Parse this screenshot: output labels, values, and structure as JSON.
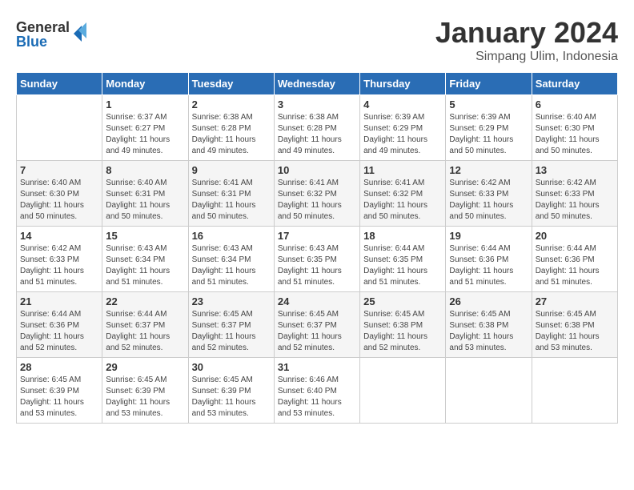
{
  "logo": {
    "line1": "General",
    "line2": "Blue"
  },
  "title": "January 2024",
  "subtitle": "Simpang Ulim, Indonesia",
  "weekdays": [
    "Sunday",
    "Monday",
    "Tuesday",
    "Wednesday",
    "Thursday",
    "Friday",
    "Saturday"
  ],
  "weeks": [
    [
      {
        "day": "",
        "sunrise": "",
        "sunset": "",
        "daylight": ""
      },
      {
        "day": "1",
        "sunrise": "Sunrise: 6:37 AM",
        "sunset": "Sunset: 6:27 PM",
        "daylight": "Daylight: 11 hours and 49 minutes."
      },
      {
        "day": "2",
        "sunrise": "Sunrise: 6:38 AM",
        "sunset": "Sunset: 6:28 PM",
        "daylight": "Daylight: 11 hours and 49 minutes."
      },
      {
        "day": "3",
        "sunrise": "Sunrise: 6:38 AM",
        "sunset": "Sunset: 6:28 PM",
        "daylight": "Daylight: 11 hours and 49 minutes."
      },
      {
        "day": "4",
        "sunrise": "Sunrise: 6:39 AM",
        "sunset": "Sunset: 6:29 PM",
        "daylight": "Daylight: 11 hours and 49 minutes."
      },
      {
        "day": "5",
        "sunrise": "Sunrise: 6:39 AM",
        "sunset": "Sunset: 6:29 PM",
        "daylight": "Daylight: 11 hours and 50 minutes."
      },
      {
        "day": "6",
        "sunrise": "Sunrise: 6:40 AM",
        "sunset": "Sunset: 6:30 PM",
        "daylight": "Daylight: 11 hours and 50 minutes."
      }
    ],
    [
      {
        "day": "7",
        "sunrise": "Sunrise: 6:40 AM",
        "sunset": "Sunset: 6:30 PM",
        "daylight": "Daylight: 11 hours and 50 minutes."
      },
      {
        "day": "8",
        "sunrise": "Sunrise: 6:40 AM",
        "sunset": "Sunset: 6:31 PM",
        "daylight": "Daylight: 11 hours and 50 minutes."
      },
      {
        "day": "9",
        "sunrise": "Sunrise: 6:41 AM",
        "sunset": "Sunset: 6:31 PM",
        "daylight": "Daylight: 11 hours and 50 minutes."
      },
      {
        "day": "10",
        "sunrise": "Sunrise: 6:41 AM",
        "sunset": "Sunset: 6:32 PM",
        "daylight": "Daylight: 11 hours and 50 minutes."
      },
      {
        "day": "11",
        "sunrise": "Sunrise: 6:41 AM",
        "sunset": "Sunset: 6:32 PM",
        "daylight": "Daylight: 11 hours and 50 minutes."
      },
      {
        "day": "12",
        "sunrise": "Sunrise: 6:42 AM",
        "sunset": "Sunset: 6:33 PM",
        "daylight": "Daylight: 11 hours and 50 minutes."
      },
      {
        "day": "13",
        "sunrise": "Sunrise: 6:42 AM",
        "sunset": "Sunset: 6:33 PM",
        "daylight": "Daylight: 11 hours and 50 minutes."
      }
    ],
    [
      {
        "day": "14",
        "sunrise": "Sunrise: 6:42 AM",
        "sunset": "Sunset: 6:33 PM",
        "daylight": "Daylight: 11 hours and 51 minutes."
      },
      {
        "day": "15",
        "sunrise": "Sunrise: 6:43 AM",
        "sunset": "Sunset: 6:34 PM",
        "daylight": "Daylight: 11 hours and 51 minutes."
      },
      {
        "day": "16",
        "sunrise": "Sunrise: 6:43 AM",
        "sunset": "Sunset: 6:34 PM",
        "daylight": "Daylight: 11 hours and 51 minutes."
      },
      {
        "day": "17",
        "sunrise": "Sunrise: 6:43 AM",
        "sunset": "Sunset: 6:35 PM",
        "daylight": "Daylight: 11 hours and 51 minutes."
      },
      {
        "day": "18",
        "sunrise": "Sunrise: 6:44 AM",
        "sunset": "Sunset: 6:35 PM",
        "daylight": "Daylight: 11 hours and 51 minutes."
      },
      {
        "day": "19",
        "sunrise": "Sunrise: 6:44 AM",
        "sunset": "Sunset: 6:36 PM",
        "daylight": "Daylight: 11 hours and 51 minutes."
      },
      {
        "day": "20",
        "sunrise": "Sunrise: 6:44 AM",
        "sunset": "Sunset: 6:36 PM",
        "daylight": "Daylight: 11 hours and 51 minutes."
      }
    ],
    [
      {
        "day": "21",
        "sunrise": "Sunrise: 6:44 AM",
        "sunset": "Sunset: 6:36 PM",
        "daylight": "Daylight: 11 hours and 52 minutes."
      },
      {
        "day": "22",
        "sunrise": "Sunrise: 6:44 AM",
        "sunset": "Sunset: 6:37 PM",
        "daylight": "Daylight: 11 hours and 52 minutes."
      },
      {
        "day": "23",
        "sunrise": "Sunrise: 6:45 AM",
        "sunset": "Sunset: 6:37 PM",
        "daylight": "Daylight: 11 hours and 52 minutes."
      },
      {
        "day": "24",
        "sunrise": "Sunrise: 6:45 AM",
        "sunset": "Sunset: 6:37 PM",
        "daylight": "Daylight: 11 hours and 52 minutes."
      },
      {
        "day": "25",
        "sunrise": "Sunrise: 6:45 AM",
        "sunset": "Sunset: 6:38 PM",
        "daylight": "Daylight: 11 hours and 52 minutes."
      },
      {
        "day": "26",
        "sunrise": "Sunrise: 6:45 AM",
        "sunset": "Sunset: 6:38 PM",
        "daylight": "Daylight: 11 hours and 53 minutes."
      },
      {
        "day": "27",
        "sunrise": "Sunrise: 6:45 AM",
        "sunset": "Sunset: 6:38 PM",
        "daylight": "Daylight: 11 hours and 53 minutes."
      }
    ],
    [
      {
        "day": "28",
        "sunrise": "Sunrise: 6:45 AM",
        "sunset": "Sunset: 6:39 PM",
        "daylight": "Daylight: 11 hours and 53 minutes."
      },
      {
        "day": "29",
        "sunrise": "Sunrise: 6:45 AM",
        "sunset": "Sunset: 6:39 PM",
        "daylight": "Daylight: 11 hours and 53 minutes."
      },
      {
        "day": "30",
        "sunrise": "Sunrise: 6:45 AM",
        "sunset": "Sunset: 6:39 PM",
        "daylight": "Daylight: 11 hours and 53 minutes."
      },
      {
        "day": "31",
        "sunrise": "Sunrise: 6:46 AM",
        "sunset": "Sunset: 6:40 PM",
        "daylight": "Daylight: 11 hours and 53 minutes."
      },
      {
        "day": "",
        "sunrise": "",
        "sunset": "",
        "daylight": ""
      },
      {
        "day": "",
        "sunrise": "",
        "sunset": "",
        "daylight": ""
      },
      {
        "day": "",
        "sunrise": "",
        "sunset": "",
        "daylight": ""
      }
    ]
  ]
}
